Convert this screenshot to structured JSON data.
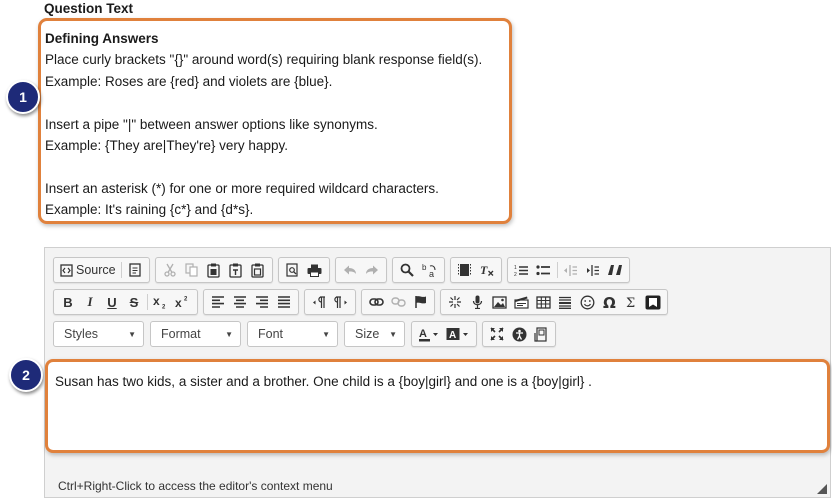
{
  "question_text_label": "Question Text",
  "instructions": {
    "heading": "Defining Answers",
    "line1": "Place curly brackets \"{}\" around word(s) requiring blank response field(s).",
    "line2": "Example: Roses are {red} and violets are {blue}.",
    "line3": "Insert a pipe \"|\" between answer options like synonyms.",
    "line4": "Example: {They are|They're} very happy.",
    "line5": "Insert an asterisk (*) for one or more required wildcard characters.",
    "line6": "Example: It's raining {c*} and {d*s}."
  },
  "badges": {
    "one": "1",
    "two": "2"
  },
  "toolbar": {
    "source_label": "Source",
    "styles_label": "Styles",
    "format_label": "Format",
    "font_label": "Font",
    "size_label": "Size",
    "bold": "B",
    "italic": "I",
    "underline": "U",
    "strike": "S"
  },
  "editor": {
    "content": "Susan has two kids, a sister and a brother. One child is a {boy|girl} and one is a {boy|girl} .",
    "status_text": "Ctrl+Right-Click to access the editor's context menu"
  },
  "colors": {
    "highlight": "#e0813c",
    "badge": "#1e2a78"
  }
}
